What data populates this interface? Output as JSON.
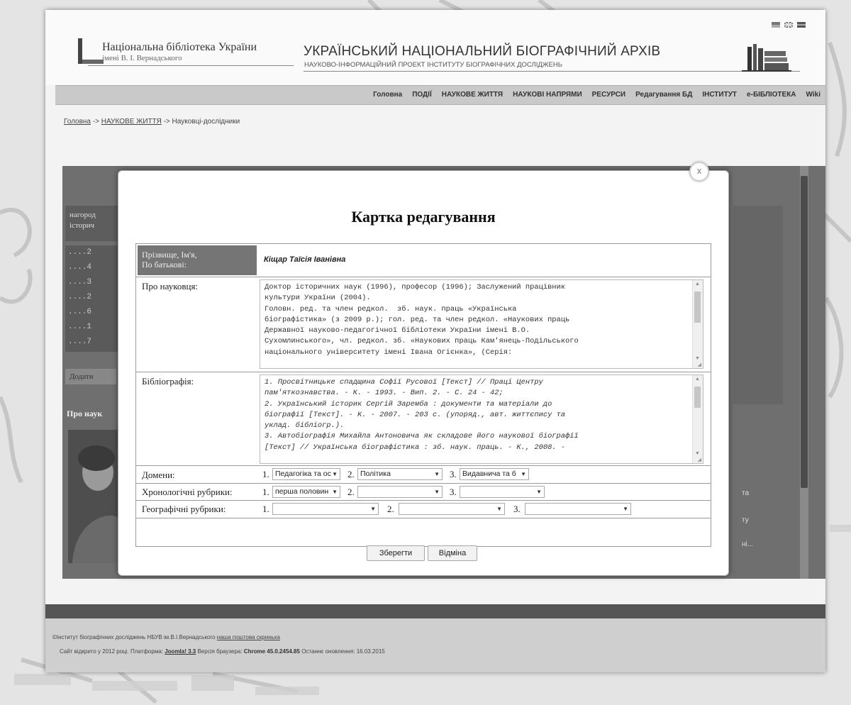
{
  "header": {
    "library_name": "Національна бібліотека України",
    "library_sub": "імені В. І. Вернадського",
    "archive_title": "УКРАЇНСЬКИЙ НАЦІОНАЛЬНИЙ БІОГРАФІЧНИЙ АРХІВ",
    "archive_sub": "НАУКОВО-ІНФОРМАЦІЙНИЙ ПРОЕКТ ІНСТИТУТУ БІОГРАФІЧНИХ ДОСЛІДЖЕНЬ"
  },
  "nav": {
    "items": [
      "Головна",
      "ПОДІЇ",
      "НАУКОВЕ ЖИТТЯ",
      "НАУКОВІ НАПРЯМИ",
      "РЕСУРСИ",
      "Редагування БД",
      "ІНСТИТУТ",
      "e-БІБЛІОТЕКА",
      "Wiki"
    ]
  },
  "breadcrumb": {
    "home": "Головна",
    "sep1": " -> ",
    "section": "НАУКОВЕ ЖИТТЯ",
    "sep2": " -> ",
    "current": "Науковці-дослідники"
  },
  "background": {
    "panel_text": "нагород\nісторич",
    "list_items": [
      "....2",
      "....4",
      "....3",
      "....2",
      "....6",
      "....1",
      "....7"
    ],
    "add_button": "Додати",
    "about_label": "Про наук",
    "right_texts": [
      "та",
      "ту",
      "ні..."
    ]
  },
  "modal": {
    "close": "x",
    "title": "Картка редагування",
    "name_label": "Прізвище, Ім'я,\nПо батькові:",
    "name_value": "Кіщар Таїсія Іванівна",
    "about_label": "Про науковця:",
    "about_text": "Доктор історичних наук (1996), професор (1996); Заслужений працівник\nкультури України (2004).\nГоловн. ред. та член редкол.  зб. наук. праць «Українська\nбіографістика» (з 2009 р.); гол. ред. та член редкол. «Наукових праць\nДержавної науково-педагогічної бібліотеки України імені В.О.\nСухомлинського», чл. редкол. зб. «Наукових праць Кам'янець-Подільського\nнаціонального університету імені Івана Огієнка», (Серія:",
    "biblio_label": "Бібліографія:",
    "biblio_text": "1. Просвітницьке спадщина Софії Русової [Текст] // Праці Центру\nпам'яткознавства. - К. - 1993. - Вип. 2. - С. 24 - 42;\n2. Український історик Сергій Заремба : документи та матеріали до\nбіографії [Текст]. - К. - 2007. - 203 с. (упоряд., авт. життєпису та\nуклад. бібліогр.).\n3. Автобіографія Михайла Антоновича як складове його наукової біографії\n[Текст] // Українська біографістика : зб. наук. праць. - К., 2008. -",
    "domains_label": "Домени:",
    "domains": [
      "Педагогіка та ос",
      "Політика",
      "Видавнича та б"
    ],
    "chrono_label": "Хронологічні рубрики:",
    "chrono": [
      "перша половин",
      "",
      ""
    ],
    "geo_label": "Географічні рубрики:",
    "geo": [
      "",
      "",
      ""
    ],
    "numbers": [
      "1.",
      "2.",
      "3."
    ],
    "save": "Зберегти",
    "cancel": "Відміна"
  },
  "footer": {
    "line1_text": "©Інститут біографічних досліджень НБУВ ім.В.І.Вернадського ",
    "line1_link": "наша поштова скринька",
    "line2_a": "Сайт відкрито у 2012 році. Платформа: ",
    "platform": "Joomla! 3.3",
    "line2_b": " Версія браузера: ",
    "browser": "Chrome 45.0.2454.85",
    "line2_c": " Останнє оновлення: 16.03.2015"
  }
}
